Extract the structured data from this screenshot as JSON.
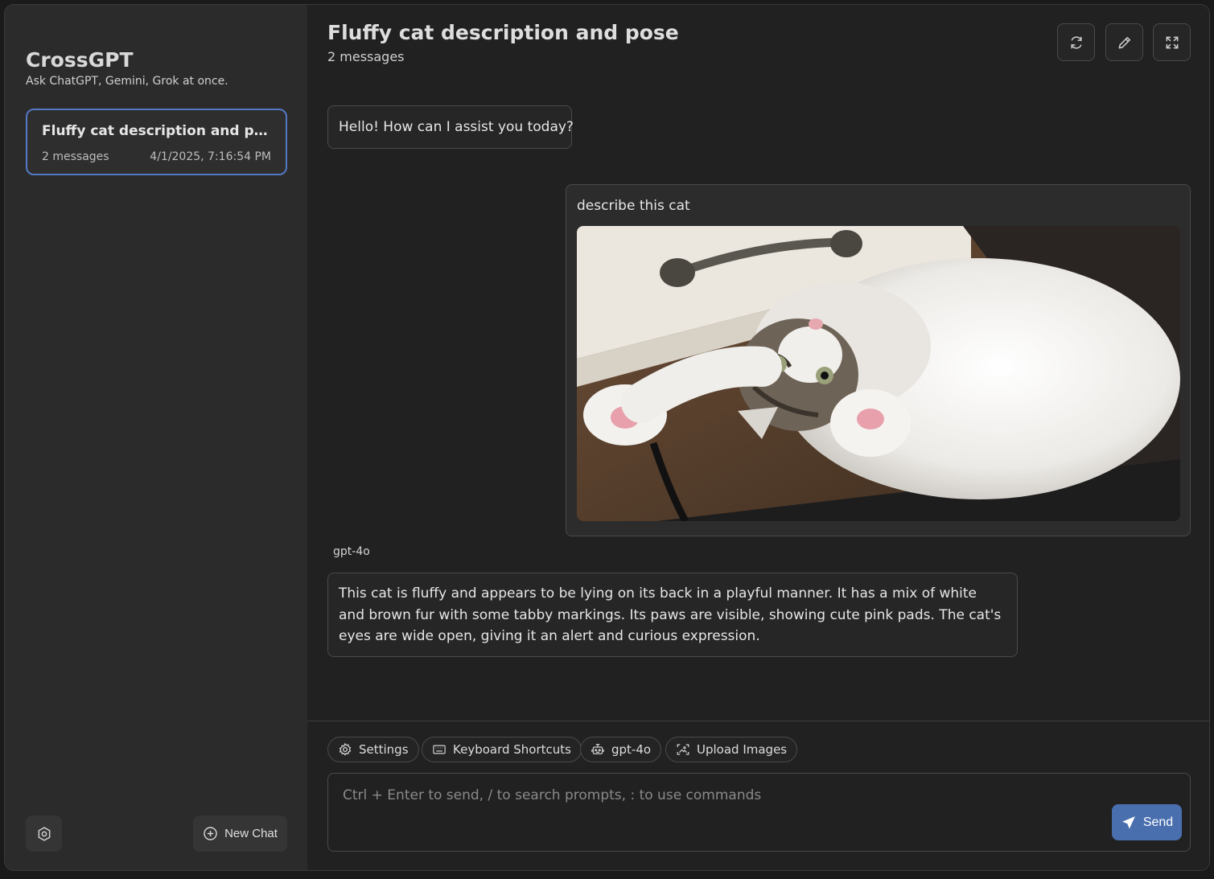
{
  "sidebar": {
    "app_name": "CrossGPT",
    "tagline": "Ask ChatGPT, Gemini, Grok at once.",
    "chats": [
      {
        "title": "Fluffy cat description and pose",
        "messages": "2 messages",
        "date": "4/1/2025, 7:16:54 PM"
      }
    ],
    "new_chat_label": "New Chat",
    "settings_icon": "settings-gear-icon"
  },
  "header": {
    "title": "Fluffy cat description and pose",
    "subtitle": "2 messages",
    "actions": [
      "refresh-icon",
      "edit-pencil-icon",
      "expand-icon"
    ]
  },
  "messages": {
    "greeting": "Hello! How can I assist you today?",
    "user_text": "describe this cat",
    "user_image": "Fluffy white and tabby kitten lying on its back under a drawer",
    "model": "gpt-4o",
    "response": "This cat is fluffy and appears to be lying on its back in a playful manner. It has a mix of white and brown fur with some tabby markings. Its paws are visible, showing cute pink pads. The cat's eyes are wide open, giving it an alert and curious expression."
  },
  "toolbar": {
    "settings": "Settings",
    "shortcuts": "Keyboard Shortcuts",
    "model": "gpt-4o",
    "upload": "Upload Images"
  },
  "composer": {
    "placeholder": "Ctrl + Enter to send, / to search prompts, : to use commands",
    "value": "",
    "send_label": "Send"
  },
  "colors": {
    "accent": "#4a6fae",
    "selected_border": "#5479c4",
    "sidebar_bg": "#2b2b2b",
    "main_bg": "#212121"
  }
}
